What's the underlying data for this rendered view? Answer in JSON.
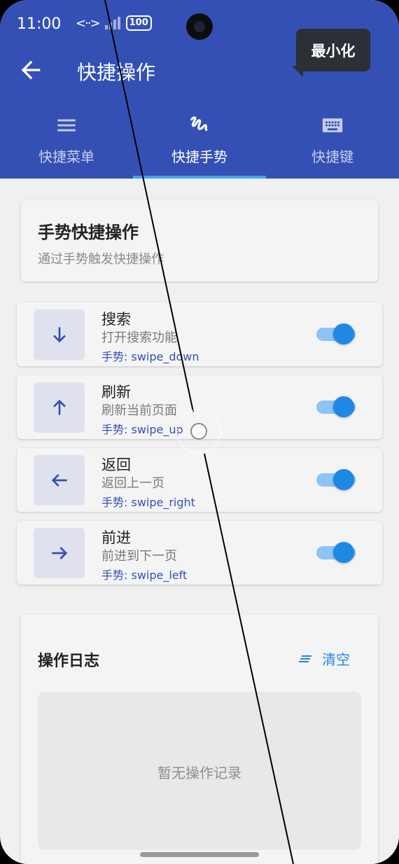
{
  "status_bar": {
    "time": "11:00",
    "nfc": "<··>",
    "battery": "100"
  },
  "app_bar": {
    "title": "快捷操作"
  },
  "tooltip": {
    "text": "最小化"
  },
  "tabs": [
    {
      "label": "快捷菜单",
      "icon": "menu-icon",
      "active": false
    },
    {
      "label": "快捷手势",
      "icon": "gesture-icon",
      "active": true
    },
    {
      "label": "快捷键",
      "icon": "keyboard-icon",
      "active": false
    }
  ],
  "intro": {
    "title": "手势快捷操作",
    "description": "通过手势触发快捷操作"
  },
  "gestures": [
    {
      "title": "搜索",
      "description": "打开搜索功能",
      "gesture": "手势: swipe_down",
      "icon": "arrow-down-icon",
      "enabled": true
    },
    {
      "title": "刷新",
      "description": "刷新当前页面",
      "gesture": "手势: swipe_up",
      "icon": "arrow-up-icon",
      "enabled": true
    },
    {
      "title": "返回",
      "description": "返回上一页",
      "gesture": "手势: swipe_right",
      "icon": "arrow-left-icon",
      "enabled": true
    },
    {
      "title": "前进",
      "description": "前进到下一页",
      "gesture": "手势: swipe_left",
      "icon": "arrow-right-icon",
      "enabled": true
    }
  ],
  "log": {
    "title": "操作日志",
    "clear_label": "清空",
    "empty_text": "暂无操作记录"
  },
  "colors": {
    "primary": "#3550b5",
    "accent": "#1e88e5",
    "tab_indicator": "#42a5f5",
    "background": "#f0f0f0"
  }
}
